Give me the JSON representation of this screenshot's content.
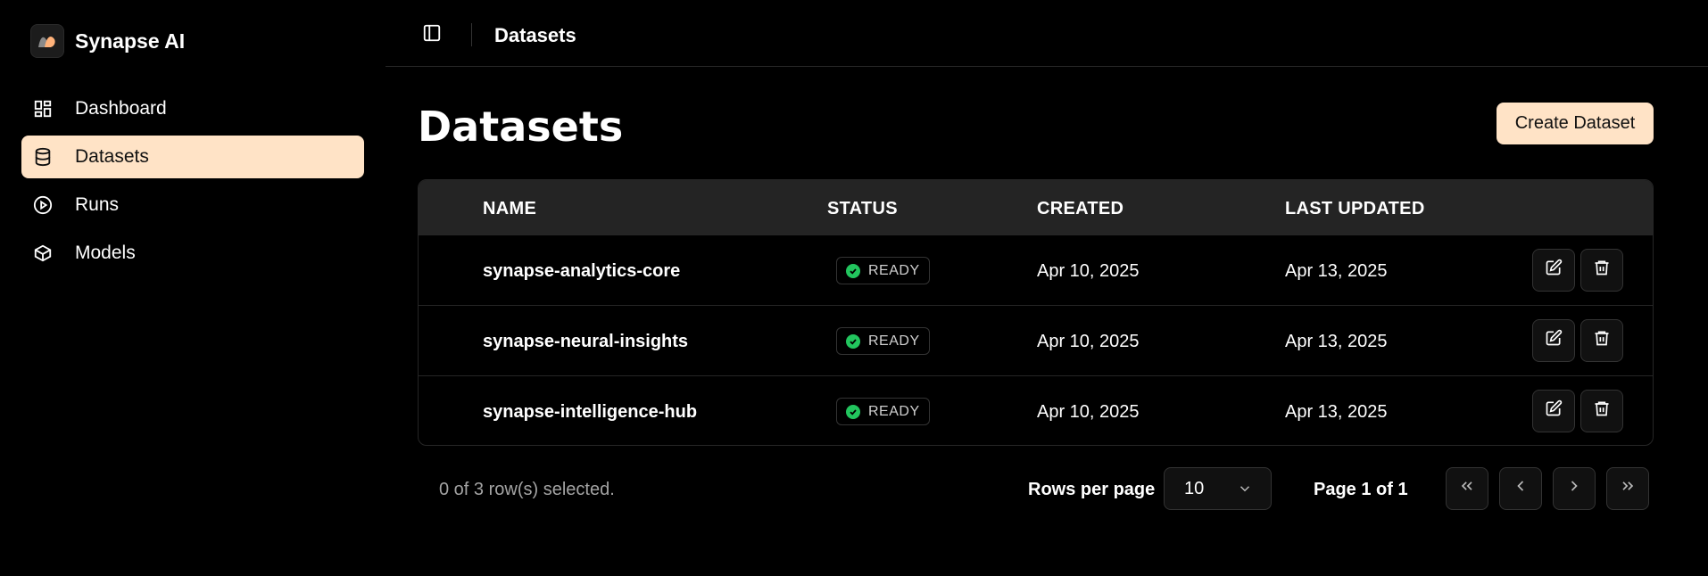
{
  "brand": {
    "name": "Synapse AI"
  },
  "sidebar": {
    "items": [
      {
        "label": "Dashboard",
        "icon": "layout-grid-icon",
        "active": false
      },
      {
        "label": "Datasets",
        "icon": "database-icon",
        "active": true
      },
      {
        "label": "Runs",
        "icon": "play-circle-icon",
        "active": false
      },
      {
        "label": "Models",
        "icon": "box-icon",
        "active": false
      }
    ]
  },
  "topbar": {
    "title": "Datasets"
  },
  "page": {
    "title": "Datasets",
    "create_label": "Create Dataset"
  },
  "table": {
    "headers": {
      "name": "NAME",
      "status": "STATUS",
      "created": "CREATED",
      "updated": "LAST UPDATED"
    },
    "rows": [
      {
        "name": "synapse-analytics-core",
        "status": "READY",
        "created": "Apr 10, 2025",
        "updated": "Apr 13, 2025"
      },
      {
        "name": "synapse-neural-insights",
        "status": "READY",
        "created": "Apr 10, 2025",
        "updated": "Apr 13, 2025"
      },
      {
        "name": "synapse-intelligence-hub",
        "status": "READY",
        "created": "Apr 10, 2025",
        "updated": "Apr 13, 2025"
      }
    ]
  },
  "footer": {
    "selection": "0 of 3 row(s) selected.",
    "rows_per_page_label": "Rows per page",
    "rows_per_page_value": "10",
    "page_info": "Page 1 of 1"
  },
  "colors": {
    "accent": "#ffe3c6",
    "ready": "#22c55e",
    "background": "#000000",
    "header": "#242424"
  }
}
